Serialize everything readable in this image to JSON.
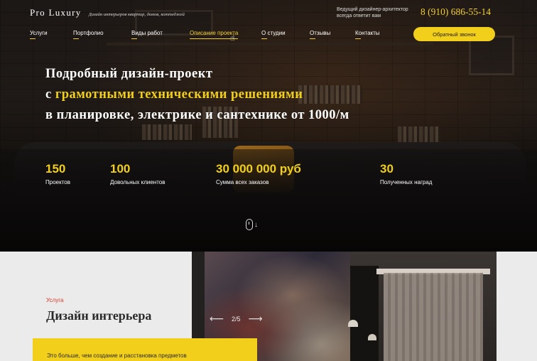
{
  "header": {
    "logo_name": "Pro Luxury",
    "logo_tagline": "Дизайн интерьеров квартир, домов, коттеджей",
    "note_line1": "Ведущий дизайнер-архитектор",
    "note_line2": "всегда ответит вам",
    "phone": "8 (910) 686-55-14",
    "callback_label": "Обратный звонок"
  },
  "nav": {
    "items": [
      {
        "label": "Услуги"
      },
      {
        "label": "Портфолио"
      },
      {
        "label": "Виды работ"
      },
      {
        "label": "Описание проекта"
      },
      {
        "label": "О студии"
      },
      {
        "label": "Отзывы"
      },
      {
        "label": "Контакты"
      }
    ]
  },
  "hero": {
    "line1": "Подробный дизайн-проект",
    "line2_prefix": "с",
    "line2_highlight": "грамотными техническими решениями",
    "line3": "в планировке, электрике и сантехнике от 1000/м"
  },
  "stats": [
    {
      "value": "150",
      "label": "Проектов"
    },
    {
      "value": "100",
      "label": "Довольных клиентов"
    },
    {
      "value": "30 000 000 руб",
      "label": "Сумма всех заказов"
    },
    {
      "value": "30",
      "label": "Полученных наград"
    }
  ],
  "slider": {
    "prev_arrow": "⟵",
    "next_arrow": "⟶",
    "counter": "2/5"
  },
  "service": {
    "kicker": "Услуга",
    "title": "Дизайн интерьера",
    "text": "Это больше, чем создание и расстановка предметов"
  },
  "colors": {
    "accent_yellow": "#f2cf1a",
    "kicker_red": "#d83a2a",
    "light_bg": "#ebebeb"
  },
  "icons": {
    "scroll": "mouse-scroll-icon",
    "cursor": "pointer-cursor-icon"
  }
}
